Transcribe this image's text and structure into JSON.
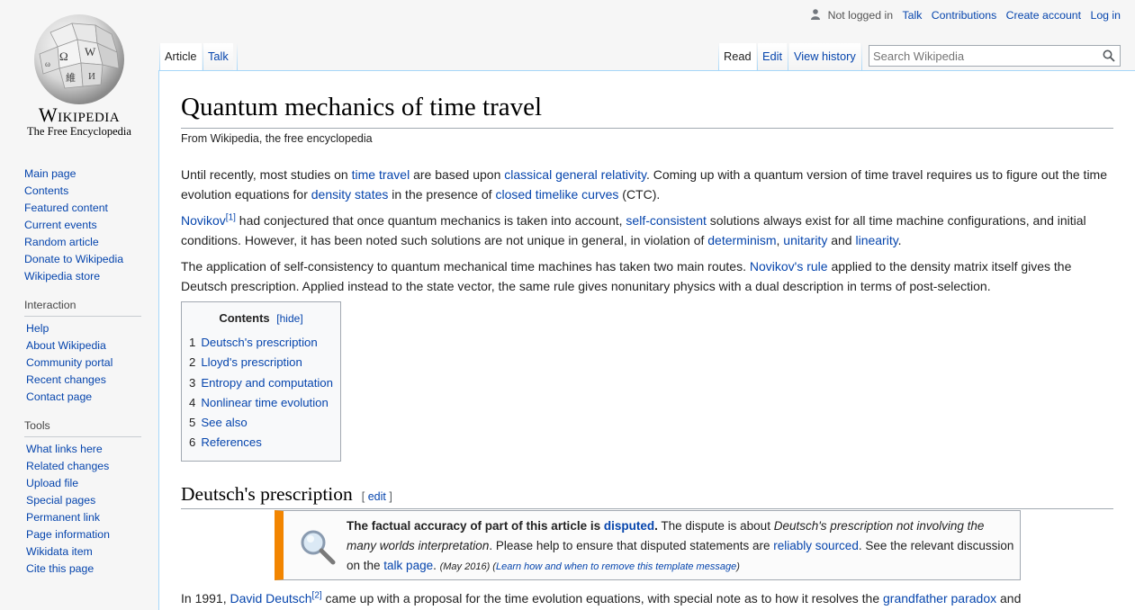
{
  "logo": {
    "wordmark": "Wikipedia",
    "tagline": "The Free Encyclopedia"
  },
  "personal": {
    "not_logged_in": "Not logged in",
    "talk": "Talk",
    "contributions": "Contributions",
    "create_account": "Create account",
    "login": "Log in"
  },
  "tabs": {
    "article": "Article",
    "talk": "Talk",
    "read": "Read",
    "edit": "Edit",
    "view_history": "View history"
  },
  "search": {
    "placeholder": "Search Wikipedia"
  },
  "sidebar": {
    "main": [
      "Main page",
      "Contents",
      "Featured content",
      "Current events",
      "Random article",
      "Donate to Wikipedia",
      "Wikipedia store"
    ],
    "interaction": {
      "heading": "Interaction",
      "items": [
        "Help",
        "About Wikipedia",
        "Community portal",
        "Recent changes",
        "Contact page"
      ]
    },
    "tools": {
      "heading": "Tools",
      "items": [
        "What links here",
        "Related changes",
        "Upload file",
        "Special pages",
        "Permanent link",
        "Page information",
        "Wikidata item",
        "Cite this page"
      ]
    }
  },
  "article": {
    "title": "Quantum mechanics of time travel",
    "site_sub": "From Wikipedia, the free encyclopedia",
    "p1": {
      "t1": "Until recently, most studies on ",
      "l1": "time travel",
      "t2": " are based upon ",
      "l2": "classical general relativity",
      "t3": ". Coming up with a quantum version of time travel requires us to figure out the time evolution equations for ",
      "l3": "density states",
      "t4": " in the presence of ",
      "l4": "closed timelike curves",
      "t5": " (CTC)."
    },
    "p2": {
      "l1": "Novikov",
      "ref": "[1]",
      "t1": " had conjectured that once quantum mechanics is taken into account, ",
      "l2": "self-consistent",
      "t2": " solutions always exist for all time machine configurations, and initial conditions. However, it has been noted such solutions are not unique in general, in violation of ",
      "l3": "determinism",
      "t3": ", ",
      "l4": "unitarity",
      "t4": " and ",
      "l5": "linearity",
      "t5": "."
    },
    "p3": {
      "t1": "The application of self-consistency to quantum mechanical time machines has taken two main routes. ",
      "l1": "Novikov's rule",
      "t2": " applied to the density matrix itself gives the Deutsch prescription. Applied instead to the state vector, the same rule gives nonunitary physics with a dual description in terms of post-selection."
    },
    "toc": {
      "title": "Contents",
      "hide": "[hide]",
      "items": [
        {
          "num": "1",
          "label": "Deutsch's prescription"
        },
        {
          "num": "2",
          "label": "Lloyd's prescription"
        },
        {
          "num": "3",
          "label": "Entropy and computation"
        },
        {
          "num": "4",
          "label": "Nonlinear time evolution"
        },
        {
          "num": "5",
          "label": "See also"
        },
        {
          "num": "6",
          "label": "References"
        }
      ]
    },
    "section1": {
      "heading": "Deutsch's prescription",
      "edit_open": "[ ",
      "edit": "edit",
      "edit_close": " ]"
    },
    "ambox": {
      "b1": "The factual accuracy of part of this article is ",
      "b_link": "disputed",
      "b2": ".",
      "t1": " The dispute is about ",
      "i1": "Deutsch's prescription not involving the many worlds interpretation",
      "t2": ". Please help to ensure that disputed statements are ",
      "l1": "reliably sourced",
      "t3": ". See the relevant discussion on the ",
      "l2": "talk page",
      "t4": ". ",
      "date": "(May 2016)",
      "learn_open": " (",
      "learn": "Learn how and when to remove this template message",
      "learn_close": ")"
    },
    "cutoff": {
      "t1": "In 1991, ",
      "l1": "David Deutsch",
      "ref": "[2]",
      "t2": " came up with a proposal for the time evolution equations, with special note as to how it resolves the ",
      "l2": "grandfather paradox",
      "t3": " and"
    }
  },
  "colors": {
    "link": "#0645ad",
    "ambox_bar": "#f28500",
    "border": "#a7d7f9"
  }
}
